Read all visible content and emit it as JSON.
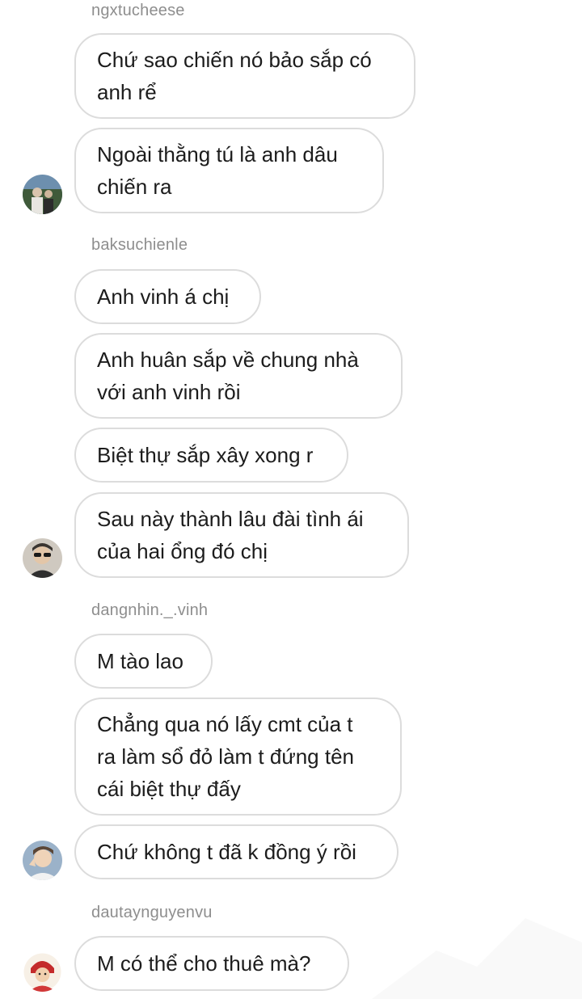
{
  "thread": {
    "groups": [
      {
        "username": "ngxtucheese",
        "messages": [
          "Chứ sao chiến nó bảo sắp có\nanh rể",
          "Ngoài thằng tú là anh dâu\nchiến ra"
        ]
      },
      {
        "username": "baksuchienle",
        "messages": [
          "Anh vinh á chị",
          "Anh huân sắp về chung nhà\nvới anh vinh rồi",
          "Biệt thự sắp xây xong r",
          "Sau này thành lâu đài tình ái\ncủa hai ổng đó chị"
        ]
      },
      {
        "username": "dangnhin._.vinh",
        "messages": [
          "M tào lao",
          "Chẳng qua nó lấy cmt của t\nra làm sổ đỏ làm t đứng tên\ncái biệt thự đấy",
          "Chứ không t đã k đồng ý rồi"
        ]
      },
      {
        "username": "dautaynguyenvu",
        "messages": [
          "M có thể cho thuê mà?"
        ]
      }
    ],
    "avatars": [
      "avatar-icon",
      "avatar-icon",
      "avatar-icon",
      "avatar-icon"
    ],
    "colors": {
      "bubble_border": "#dcdcdc",
      "username": "#8e8e8e",
      "text": "#1c1c1c"
    }
  }
}
